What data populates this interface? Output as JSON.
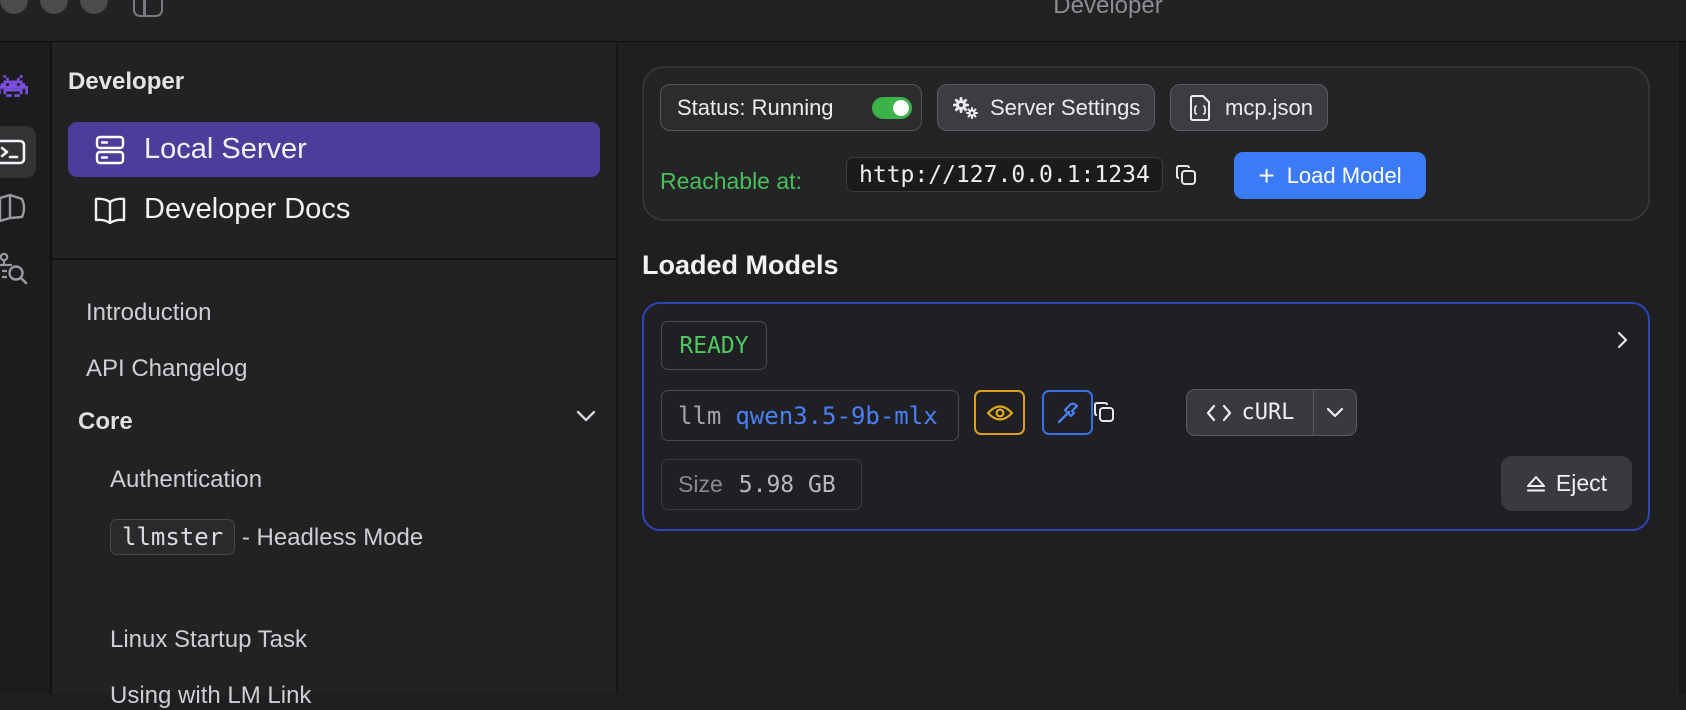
{
  "window": {
    "title": "Developer"
  },
  "rail": {
    "icons": [
      "space-invader-icon",
      "terminal-icon",
      "book-map-icon",
      "search-models-icon"
    ]
  },
  "sidebar": {
    "heading": "Developer",
    "nav": [
      {
        "label": "Local Server",
        "icon": "server-icon",
        "active": true
      },
      {
        "label": "Developer Docs",
        "icon": "book-icon",
        "active": false
      }
    ],
    "links": [
      "Introduction",
      "API Changelog"
    ],
    "section": {
      "title": "Core",
      "items": [
        {
          "code": "Authentication"
        },
        {
          "code": "llmster",
          "suffix": " - Headless Mode"
        },
        {
          "code": "Linux Startup Task"
        },
        {
          "code": "Using with LM Link"
        }
      ]
    }
  },
  "server": {
    "status_label": "Status: Running",
    "status_on": true,
    "settings_label": "Server Settings",
    "mcp_label": "mcp.json",
    "reachable_label": "Reachable at:",
    "url": "http://127.0.0.1:1234",
    "load_model_label": "Load Model"
  },
  "loaded_models": {
    "title": "Loaded Models",
    "model": {
      "status": "READY",
      "type": "llm",
      "name": "qwen3.5-9b-mlx",
      "curl_label": "cURL",
      "size_label": "Size",
      "size_value": "5.98 GB",
      "eject_label": "Eject"
    }
  },
  "colors": {
    "accent_purple": "#4a3e9a",
    "accent_blue": "#3b7bf7",
    "ready_green": "#4ec960",
    "reachable_green": "#47c05a",
    "model_border": "#2c46b8",
    "vision_yellow": "#d9a11c"
  }
}
